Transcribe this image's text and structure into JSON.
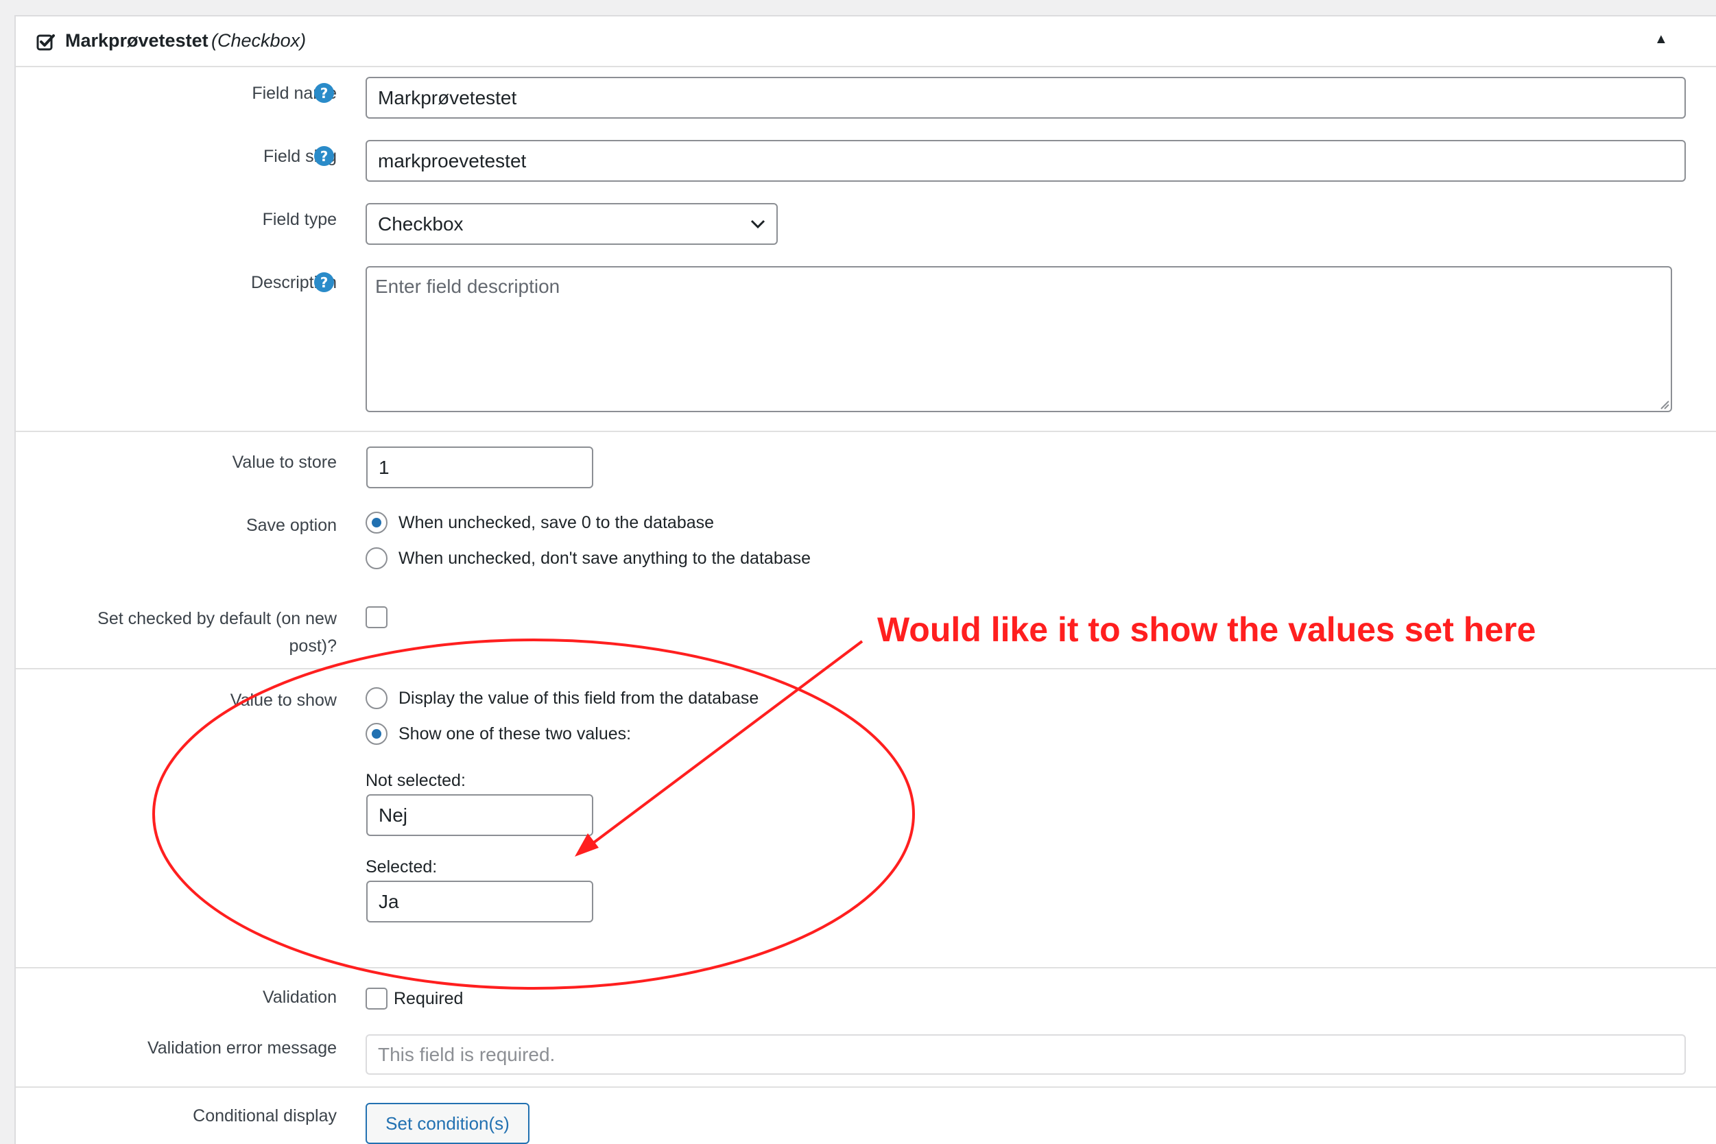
{
  "header": {
    "icon": "checkbox-icon",
    "title": "Markprøvetestet",
    "type": "(Checkbox)",
    "toggle": "▲"
  },
  "fields": {
    "field_name": {
      "label": "Field name",
      "value": "Markprøvetestet"
    },
    "field_slug": {
      "label": "Field slug",
      "value": "markproevetestet"
    },
    "field_type": {
      "label": "Field type",
      "value": "Checkbox"
    },
    "description": {
      "label": "Description",
      "placeholder": "Enter field description"
    }
  },
  "storage": {
    "value_to_store": {
      "label": "Value to store",
      "value": "1"
    },
    "save_option": {
      "label": "Save option",
      "options": [
        {
          "label": "When unchecked, save 0 to the database",
          "checked": true
        },
        {
          "label": "When unchecked, don't save anything to the database",
          "checked": false
        }
      ]
    },
    "checked_default": {
      "label_line1": "Set checked by default (on new",
      "label_line2": "post)?",
      "checked": false
    }
  },
  "display": {
    "label": "Value to show",
    "options": [
      {
        "label": "Display the value of this field from the database",
        "checked": false
      },
      {
        "label": "Show one of these two values:",
        "checked": true
      }
    ],
    "not_selected": {
      "label": "Not selected:",
      "value": "Nej"
    },
    "selected": {
      "label": "Selected:",
      "value": "Ja"
    }
  },
  "validation": {
    "label": "Validation",
    "required_label": "Required",
    "required_checked": false,
    "error_label": "Validation error message",
    "error_placeholder": "This field is required."
  },
  "conditional": {
    "label": "Conditional display",
    "button": "Set condition(s)"
  },
  "annotation": {
    "text": "Would like it to show the values set here",
    "color": "#ff1f1f"
  },
  "colors": {
    "accent": "#2271b1",
    "help": "#2a8bc9"
  }
}
